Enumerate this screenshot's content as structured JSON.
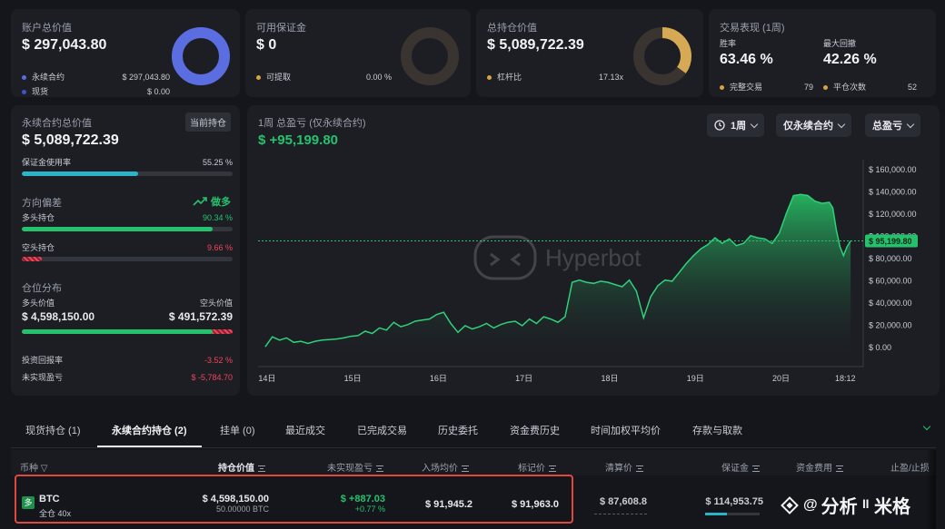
{
  "cards": {
    "account": {
      "label": "账户总价值",
      "value": "$ 297,043.80",
      "rows": [
        {
          "name": "永续合约",
          "value": "$ 297,043.80",
          "color": "#5b6ee1"
        },
        {
          "name": "现货",
          "value": "$ 0.00",
          "color": "#3f54c9"
        }
      ],
      "ring": 1.0,
      "ring_color": "#5b6ee1"
    },
    "margin": {
      "label": "可用保证金",
      "value": "$ 0",
      "rows": [
        {
          "name": "可提取",
          "value": "0.00 %",
          "color": "#d9a43b"
        }
      ],
      "ring": 0.0,
      "ring_color": "#3a3431"
    },
    "position": {
      "label": "总持仓价值",
      "value": "$ 5,089,722.39",
      "rows": [
        {
          "name": "杠杆比",
          "value": "17.13x",
          "color": "#d9a43b"
        }
      ],
      "ring": 0.35,
      "ring_color": "#d6aa55"
    },
    "performance": {
      "label": "交易表现 (1周)",
      "winrate_label": "胜率",
      "winrate": "63.46 %",
      "dd_label": "最大回撤",
      "dd": "42.26 %",
      "trades_label": "完整交易",
      "trades": "79",
      "closes_label": "平仓次数",
      "closes": "52"
    }
  },
  "left": {
    "title": "永续合约总价值",
    "badge": "当前持仓",
    "value": "$ 5,089,722.39",
    "margin_use_label": "保证金使用率",
    "margin_use": "55.25 %",
    "margin_use_frac": 0.5525,
    "bias_label": "方向偏差",
    "bias_value": "做多",
    "long_label": "多头持仓",
    "long_pct": "90.34 %",
    "long_frac": 0.9034,
    "short_label": "空头持仓",
    "short_pct": "9.66 %",
    "short_frac": 0.0966,
    "dist_label": "仓位分布",
    "long_val_label": "多头价值",
    "short_val_label": "空头价值",
    "long_val": "$ 4,598,150.00",
    "short_val": "$ 491,572.39",
    "dist_frac": 0.9034,
    "roi_label": "投资回报率",
    "roi": "-3.52 %",
    "upnl_label": "未实现盈亏",
    "upnl": "$ -5,784.70"
  },
  "chart": {
    "title": "1周 总盈亏 (仅永续合约)",
    "value": "$ +95,199.80",
    "controls": {
      "period": "1周",
      "scope": "仅永续合约",
      "metric": "总盈亏"
    },
    "watermark": "Hyperbot",
    "current_label": "$ 95,199.80"
  },
  "chart_data": {
    "type": "area",
    "yticks": [
      "$ 0.00",
      "$ 20,000.00",
      "$ 40,000.00",
      "$ 60,000.00",
      "$ 80,000.00",
      "$ 100,000.00",
      "$ 120,000.00",
      "$ 140,000.00",
      "$ 160,000.00"
    ],
    "ylim": [
      -8000,
      165000
    ],
    "xticks": [
      {
        "label": "14日",
        "t": 0.5
      },
      {
        "label": "15日",
        "t": 24.5
      },
      {
        "label": "16日",
        "t": 48.5
      },
      {
        "label": "17日",
        "t": 72.5
      },
      {
        "label": "18日",
        "t": 96.5
      },
      {
        "label": "19日",
        "t": 120.5
      },
      {
        "label": "20日",
        "t": 144.5
      },
      {
        "label": "18:12",
        "t": 162.5
      }
    ],
    "xlim": [
      -2,
      166
    ],
    "current": 95199.8,
    "series": [
      {
        "values": [
          [
            0,
            0
          ],
          [
            2,
            9000
          ],
          [
            4,
            6000
          ],
          [
            6,
            8000
          ],
          [
            8,
            4000
          ],
          [
            10,
            5000
          ],
          [
            12,
            3000
          ],
          [
            14,
            5000
          ],
          [
            16,
            6000
          ],
          [
            18,
            6500
          ],
          [
            20,
            7000
          ],
          [
            22,
            8000
          ],
          [
            24,
            9500
          ],
          [
            26,
            10000
          ],
          [
            28,
            14000
          ],
          [
            30,
            12000
          ],
          [
            32,
            17000
          ],
          [
            34,
            15000
          ],
          [
            36,
            22000
          ],
          [
            38,
            18000
          ],
          [
            40,
            20000
          ],
          [
            42,
            23000
          ],
          [
            44,
            24000
          ],
          [
            46,
            25000
          ],
          [
            48,
            29000
          ],
          [
            50,
            31000
          ],
          [
            52,
            21000
          ],
          [
            54,
            13000
          ],
          [
            56,
            19000
          ],
          [
            58,
            16000
          ],
          [
            60,
            18000
          ],
          [
            62,
            21000
          ],
          [
            64,
            17000
          ],
          [
            66,
            20000
          ],
          [
            68,
            22000
          ],
          [
            70,
            23000
          ],
          [
            72,
            19000
          ],
          [
            74,
            25000
          ],
          [
            76,
            21000
          ],
          [
            78,
            27000
          ],
          [
            80,
            25000
          ],
          [
            82,
            22000
          ],
          [
            84,
            27000
          ],
          [
            86,
            58000
          ],
          [
            88,
            60000
          ],
          [
            90,
            58000
          ],
          [
            92,
            57000
          ],
          [
            94,
            59000
          ],
          [
            96,
            58000
          ],
          [
            98,
            56000
          ],
          [
            100,
            54000
          ],
          [
            102,
            60000
          ],
          [
            104,
            50000
          ],
          [
            106,
            26000
          ],
          [
            108,
            45000
          ],
          [
            110,
            55000
          ],
          [
            112,
            60000
          ],
          [
            114,
            59000
          ],
          [
            116,
            67000
          ],
          [
            118,
            75000
          ],
          [
            120,
            82000
          ],
          [
            122,
            88000
          ],
          [
            124,
            92000
          ],
          [
            126,
            98000
          ],
          [
            128,
            93000
          ],
          [
            130,
            97000
          ],
          [
            132,
            91000
          ],
          [
            134,
            93000
          ],
          [
            136,
            100000
          ],
          [
            138,
            98000
          ],
          [
            140,
            97000
          ],
          [
            142,
            93000
          ],
          [
            144,
            102000
          ],
          [
            146,
            120000
          ],
          [
            148,
            136000
          ],
          [
            150,
            137000
          ],
          [
            152,
            136000
          ],
          [
            154,
            131000
          ],
          [
            156,
            129000
          ],
          [
            158,
            130000
          ],
          [
            159,
            125000
          ],
          [
            160,
            105000
          ],
          [
            161,
            90000
          ],
          [
            162,
            82000
          ],
          [
            163,
            90000
          ],
          [
            164,
            95200
          ]
        ]
      }
    ]
  },
  "tabs": [
    {
      "label": "现货持仓 (1)"
    },
    {
      "label": "永续合约持仓 (2)"
    },
    {
      "label": "挂单 (0)"
    },
    {
      "label": "最近成交"
    },
    {
      "label": "已完成交易"
    },
    {
      "label": "历史委托"
    },
    {
      "label": "资金费历史"
    },
    {
      "label": "时间加权平均价"
    },
    {
      "label": "存款与取款"
    }
  ],
  "table": {
    "headers": [
      "币种",
      "持仓价值",
      "未实现盈亏",
      "入场均价",
      "标记价",
      "清算价",
      "保证金",
      "资金费用",
      "止盈/止损"
    ],
    "row": {
      "badge": "多",
      "symbol": "BTC",
      "mode": "全仓 40x",
      "value": "$ 4,598,150.00",
      "size": "50.00000 BTC",
      "upnl": "$ +887.03",
      "upnl_pct": "+0.77 %",
      "entry": "$ 91,945.2",
      "mark": "$ 91,963.0",
      "liq": "$ 87,608.8",
      "margin": "$ 114,953.75"
    },
    "overlay_brand": "分析 ᴵᴵ 米格",
    "overlay_handle": "@"
  }
}
